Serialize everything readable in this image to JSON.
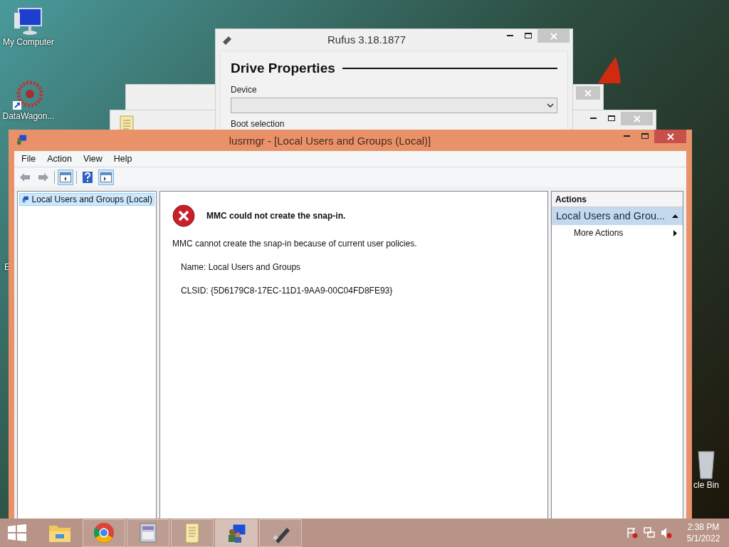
{
  "desktop_icons": [
    {
      "kind": "computer",
      "label": "My Computer"
    },
    {
      "kind": "shortcut",
      "label": "DataWagon..."
    },
    {
      "kind": "cut",
      "label": "E"
    },
    {
      "kind": "bin",
      "label": "cle Bin"
    }
  ],
  "rufus": {
    "title": "Rufus 3.18.1877",
    "section": "Drive Properties",
    "device_label": "Device",
    "boot_label": "Boot selection"
  },
  "main": {
    "title": "lusrmgr - [Local Users and Groups (Local)]",
    "menu": [
      "File",
      "Action",
      "View",
      "Help"
    ],
    "toolbar": [
      {
        "kind": "back",
        "pressed": false
      },
      {
        "kind": "forward",
        "pressed": false
      },
      {
        "kind": "tree",
        "pressed": true
      },
      {
        "kind": "help",
        "pressed": false
      },
      {
        "kind": "pane",
        "pressed": true
      }
    ],
    "tree": [
      {
        "label": "Local Users and Groups (Local)",
        "selected": true
      }
    ],
    "error": {
      "heading": "MMC could not create the snap-in.",
      "message": "MMC cannot create the snap-in because of current user policies.",
      "name": "Name: Local Users and Groups",
      "clsid": "CLSID: {5D6179C8-17EC-11D1-9AA9-00C04FD8FE93}"
    },
    "actions": {
      "title": "Actions",
      "groups": [
        {
          "label": "Local Users and Grou...",
          "expanded": true,
          "items": [
            "More Actions"
          ]
        }
      ]
    }
  },
  "taskbar": {
    "items": [
      {
        "kind": "explorer",
        "running": false,
        "selected": false
      },
      {
        "kind": "chrome",
        "running": true,
        "selected": false
      },
      {
        "kind": "archive",
        "running": true,
        "selected": false
      },
      {
        "kind": "notepad",
        "running": true,
        "selected": false
      },
      {
        "kind": "mmc",
        "running": true,
        "selected": true
      },
      {
        "kind": "usb",
        "running": true,
        "selected": false
      }
    ],
    "time": "2:38 PM",
    "date": "5/1/2022"
  }
}
